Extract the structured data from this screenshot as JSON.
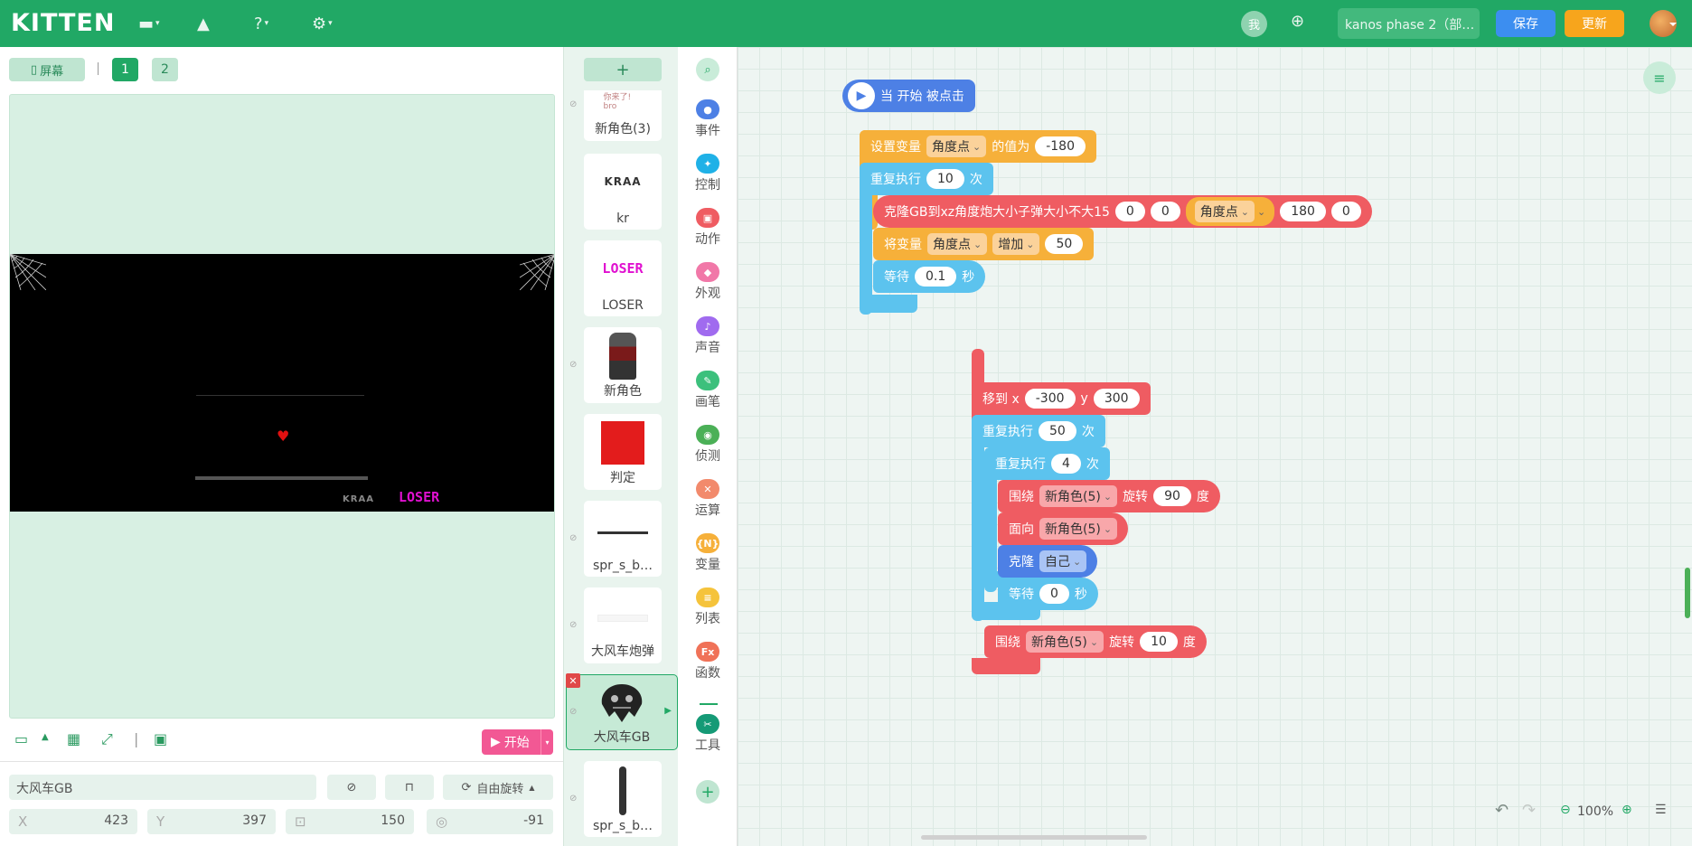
{
  "app": {
    "logo": "KITTEN",
    "user_badge": "我",
    "project_title": "kanos phase 2（部…",
    "save": "保存",
    "update": "更新"
  },
  "stage": {
    "screen_btn": "屏幕",
    "pages": [
      "1",
      "2"
    ],
    "game": {
      "kr_text": "KRAA",
      "loser_text": "LOSER"
    },
    "start_label": "开始",
    "sprite_name": "大风车GB",
    "rotate_mode": "自由旋转",
    "props": {
      "x": "423",
      "y": "397",
      "size": "150",
      "dir": "-91"
    }
  },
  "sprites": [
    {
      "name": "新角色(3)",
      "caption": "你来了! bro"
    },
    {
      "name": "kr",
      "img_text": "KRAA"
    },
    {
      "name": "LOSER",
      "img_text": "LOSER"
    },
    {
      "name": "新角色"
    },
    {
      "name": "判定"
    },
    {
      "name": "spr_s_b…"
    },
    {
      "name": "大风车炮弹"
    },
    {
      "name": "大风车GB",
      "selected": true
    },
    {
      "name": "spr_s_b…"
    }
  ],
  "categories": [
    {
      "label": "事件",
      "color": "#4d80e5"
    },
    {
      "label": "控制",
      "color": "#1fb1e7"
    },
    {
      "label": "动作",
      "color": "#ef5c62"
    },
    {
      "label": "外观",
      "color": "#f178a8"
    },
    {
      "label": "声音",
      "color": "#a06bef"
    },
    {
      "label": "画笔",
      "color": "#3cc07c"
    },
    {
      "label": "侦测",
      "color": "#4bb057"
    },
    {
      "label": "运算",
      "color": "#f28a6c"
    },
    {
      "label": "变量",
      "color": "#f6b03a",
      "badge": "{N}"
    },
    {
      "label": "列表",
      "color": "#f5c33b"
    },
    {
      "label": "函数",
      "color": "#f07258",
      "badge": "Fx"
    },
    {
      "label": "工具",
      "color": "#159a76"
    }
  ],
  "script1": {
    "hat": "当 开始 被点击",
    "set_var": {
      "pre": "设置变量",
      "var": "角度点",
      "mid": "的值为",
      "val": "-180"
    },
    "repeat": {
      "pre": "重复执行",
      "n": "10",
      "post": "次"
    },
    "clone": {
      "pre": "克隆GB到xz角度炮大小子弹大小不大15",
      "a": "0",
      "b": "0",
      "var": "角度点",
      "c": "180",
      "d": "0"
    },
    "change_var": {
      "pre": "将变量",
      "var": "角度点",
      "op": "增加",
      "val": "50"
    },
    "wait": {
      "pre": "等待",
      "val": "0.1",
      "post": "秒"
    }
  },
  "script2": {
    "goto": {
      "pre": "移到 x",
      "x": "-300",
      "ylab": "y",
      "y": "300"
    },
    "repeat_outer": {
      "pre": "重复执行",
      "n": "50",
      "post": "次"
    },
    "repeat_inner": {
      "pre": "重复执行",
      "n": "4",
      "post": "次"
    },
    "orbit1": {
      "pre": "围绕",
      "target": "新角色(5)",
      "mid": "旋转",
      "val": "90",
      "post": "度"
    },
    "face": {
      "pre": "面向",
      "target": "新角色(5)"
    },
    "clone": {
      "pre": "克隆",
      "target": "自己"
    },
    "wait": {
      "pre": "等待",
      "val": "0",
      "post": "秒"
    },
    "orbit2": {
      "pre": "围绕",
      "target": "新角色(5)",
      "mid": "旋转",
      "val": "10",
      "post": "度"
    }
  },
  "workspace": {
    "zoom": "100%"
  }
}
